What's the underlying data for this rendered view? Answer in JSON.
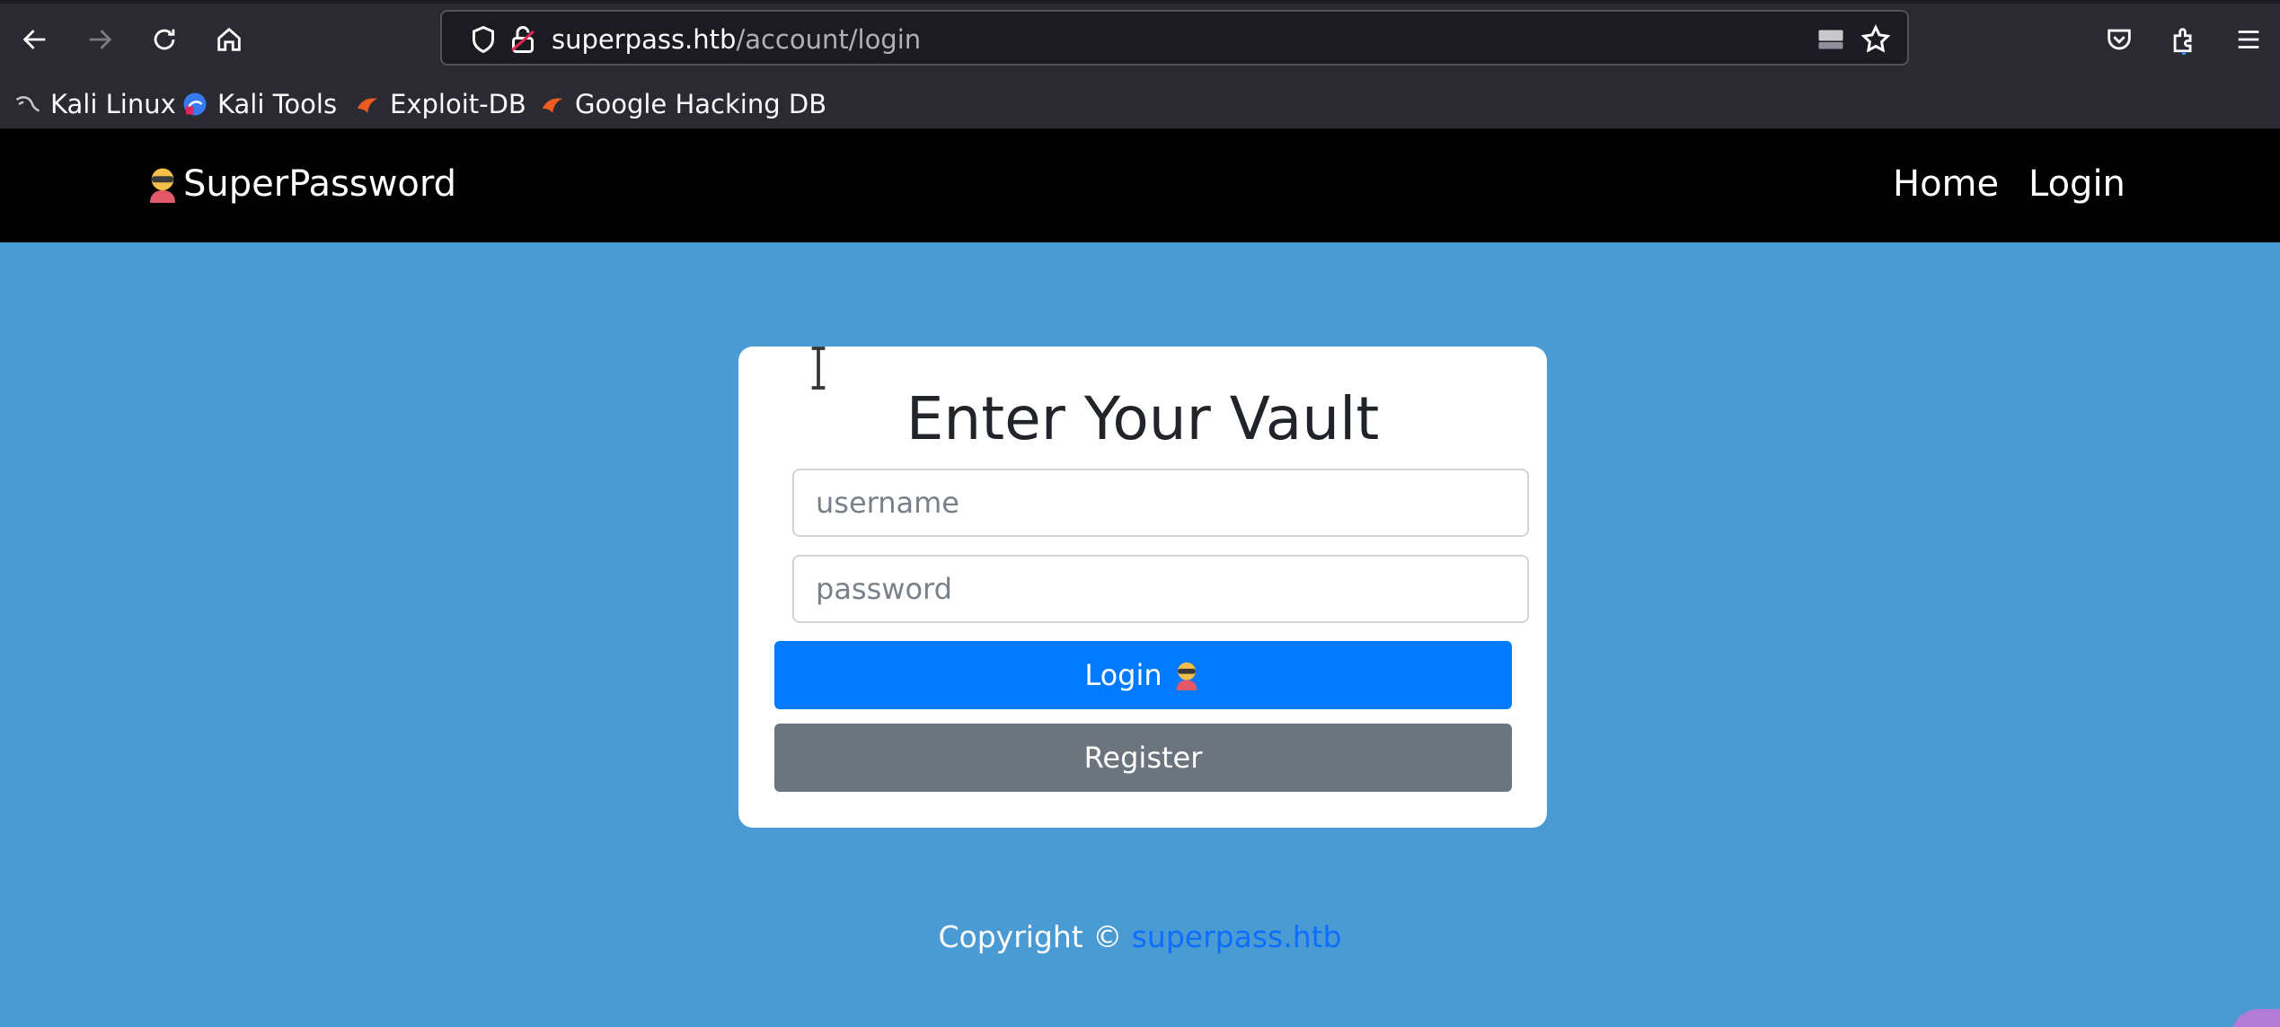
{
  "browser": {
    "url_host": "superpass.htb",
    "url_path": "/account/login",
    "bookmarks": [
      {
        "label": "Kali Linux",
        "icon": "kali-dragon-icon"
      },
      {
        "label": "Kali Tools",
        "icon": "kali-tools-icon"
      },
      {
        "label": "Exploit-DB",
        "icon": "exploit-db-icon"
      },
      {
        "label": "Google Hacking DB",
        "icon": "ghdb-icon"
      }
    ]
  },
  "site": {
    "brand": "SuperPassword",
    "nav": {
      "home": "Home",
      "login": "Login"
    }
  },
  "login_card": {
    "title": "Enter Your Vault",
    "username_placeholder": "username",
    "password_placeholder": "password",
    "login_label": "Login",
    "register_label": "Register"
  },
  "footer": {
    "copyright": "Copyright ©",
    "link_text": "superpass.htb"
  },
  "colors": {
    "page_bg": "#4a9bd3",
    "navbar_bg": "#000000",
    "primary": "#007bff",
    "secondary": "#6c757d"
  }
}
